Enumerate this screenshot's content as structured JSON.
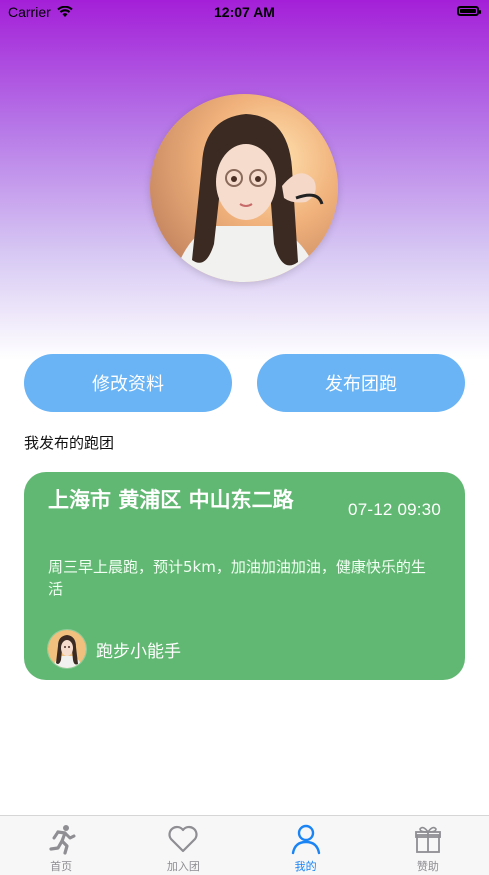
{
  "status_bar": {
    "carrier": "Carrier",
    "time": "12:07 AM"
  },
  "actions": {
    "edit_profile": "修改资料",
    "publish_run": "发布团跑"
  },
  "section": {
    "title": "我发布的跑团"
  },
  "card": {
    "location": "上海市 黄浦区 中山东二路",
    "datetime": "07-12 09:30",
    "description": "周三早上晨跑，预计5km，加油加油加油，健康快乐的生活",
    "username": "跑步小能手",
    "color": "#61b872"
  },
  "tabs": [
    {
      "label": "首页",
      "icon": "running-icon",
      "active": false
    },
    {
      "label": "加入团",
      "icon": "heart-icon",
      "active": false
    },
    {
      "label": "我的",
      "icon": "user-icon",
      "active": true
    },
    {
      "label": "赞助",
      "icon": "gift-icon",
      "active": false
    }
  ],
  "colors": {
    "accent": "#6ab4f6",
    "tab_active": "#1a84f5",
    "gradient_top": "#a41fd8"
  }
}
